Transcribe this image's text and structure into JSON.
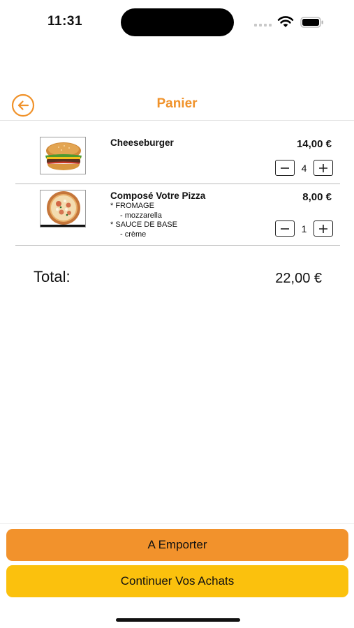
{
  "status_bar": {
    "time": "11:31"
  },
  "header": {
    "title": "Panier"
  },
  "cart": {
    "items": [
      {
        "name": "Cheeseburger",
        "price": "14,00 €",
        "quantity": "4",
        "image_icon": "burger-icon",
        "options": []
      },
      {
        "name": "Composé Votre Pizza",
        "price": "8,00 €",
        "quantity": "1",
        "image_icon": "pizza-icon",
        "options": [
          {
            "group": "* FROMAGE",
            "choice": "- mozzarella"
          },
          {
            "group": "* SAUCE DE BASE",
            "choice": "- crème"
          }
        ]
      }
    ]
  },
  "total": {
    "label": "Total:",
    "value": "22,00 €"
  },
  "actions": {
    "takeaway_label": "A Emporter",
    "continue_label": "Continuer Vos Achats"
  },
  "colors": {
    "accent": "#f0922a",
    "takeaway_button": "#f2922c",
    "continue_button": "#fbc10d"
  }
}
